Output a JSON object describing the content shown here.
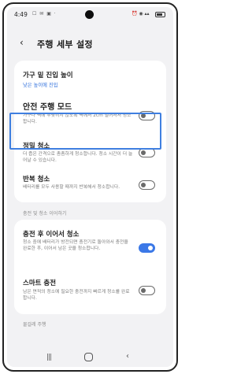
{
  "status": {
    "time": "4:49",
    "left_icons": "☐ ✉ ▣ ·",
    "right_icons": "⏰ ◉ ▴▴"
  },
  "header": {
    "back_icon": "‹",
    "title": "주행 세부 설정"
  },
  "settings": {
    "furniture": {
      "title": "가구 밑 진입 높이",
      "value": "낮은 높이에 진입"
    },
    "safe_mode": {
      "title": "안전 주행 모드",
      "desc": "가구나 벽에 부딪히지 않도록 벽에서 2cm 떨어져서 청소합니다.",
      "enabled": false
    },
    "precise": {
      "title": "정밀 청소",
      "desc": "더 좁은 간격으로 촘촘하게 청소합니다. 청소 시간이 더 늘어날 수 있습니다.",
      "enabled": false
    },
    "repeat": {
      "title": "반복 청소",
      "desc": "배터리를 모두 사용할 때까지 반복해서 청소합니다.",
      "enabled": false
    }
  },
  "section_charging": {
    "label": "충전 및 청소 이어하기",
    "resume": {
      "title": "충전 후 이어서 청소",
      "desc": "청소 중에 배터리가 방전되면 충전기로 돌아와서 충전을 완료한 후, 이어서 남은 곳을 청소합니다.",
      "enabled": true
    },
    "smart": {
      "title": "스마트 충전",
      "desc": "남은 면적의 청소에 필요한 충전까지 빠르게 청소를 완료합니다.",
      "enabled": false
    }
  },
  "section_mop": {
    "label": "물걸레 주행"
  },
  "nav": {
    "recent": "|||",
    "back": "‹"
  },
  "colors": {
    "accent": "#3b78e7",
    "highlight": "#3f7fe0",
    "link": "#2f6fdc",
    "background": "#f2f2f4"
  }
}
